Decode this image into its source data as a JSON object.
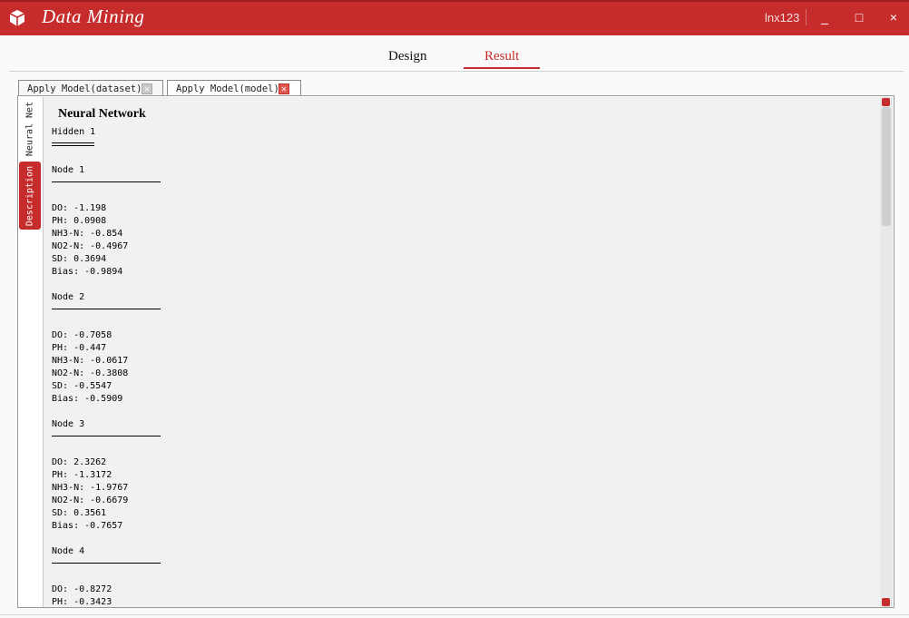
{
  "app": {
    "title": "Data Mining",
    "user": "lnx123",
    "minimize_glyph": "_",
    "maximize_glyph": "□",
    "close_glyph": "×"
  },
  "main_tabs": [
    {
      "label": "Design",
      "active": false
    },
    {
      "label": "Result",
      "active": true
    }
  ],
  "doc_tabs": [
    {
      "label": "Apply Model(dataset)",
      "active": false
    },
    {
      "label": "Apply Model(model)",
      "active": true
    }
  ],
  "side_tabs": [
    {
      "label": "Neural Net",
      "active": false
    },
    {
      "label": "Description",
      "active": true
    }
  ],
  "output": {
    "title": "Neural Network",
    "hidden_label": "Hidden 1",
    "nodes": [
      {
        "title": "Node 1",
        "lines": [
          "DO: -1.198",
          "PH: 0.0908",
          "NH3-N: -0.854",
          "NO2-N: -0.4967",
          "SD: 0.3694",
          "Bias: -0.9894"
        ]
      },
      {
        "title": "Node 2",
        "lines": [
          "DO: -0.7058",
          "PH: -0.447",
          "NH3-N: -0.0617",
          "NO2-N: -0.3808",
          "SD: -0.5547",
          "Bias: -0.5909"
        ]
      },
      {
        "title": "Node 3",
        "lines": [
          "DO: 2.3262",
          "PH: -1.3172",
          "NH3-N: -1.9767",
          "NO2-N: -0.6679",
          "SD: 0.3561",
          "Bias: -0.7657"
        ]
      },
      {
        "title": "Node 4",
        "lines": [
          "DO: -0.8272",
          "PH: -0.3423"
        ]
      }
    ]
  },
  "colors": {
    "accent": "#c62c2c",
    "output_bg": "#f1f1f1"
  }
}
